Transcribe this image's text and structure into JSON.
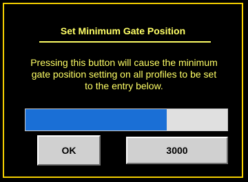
{
  "dialog": {
    "title": "Set Minimum Gate Position",
    "message": "Pressing this button will cause the minimum gate position setting on all profiles to be set to the entry below.",
    "progress_fraction": 0.7,
    "ok_label": "OK",
    "entry_value": "3000"
  },
  "colors": {
    "border": "#f5d000",
    "text": "#ffff66",
    "progress_fill": "#1a6fd6",
    "progress_track": "#e0e0e0",
    "button_face": "#d0d0d0"
  }
}
